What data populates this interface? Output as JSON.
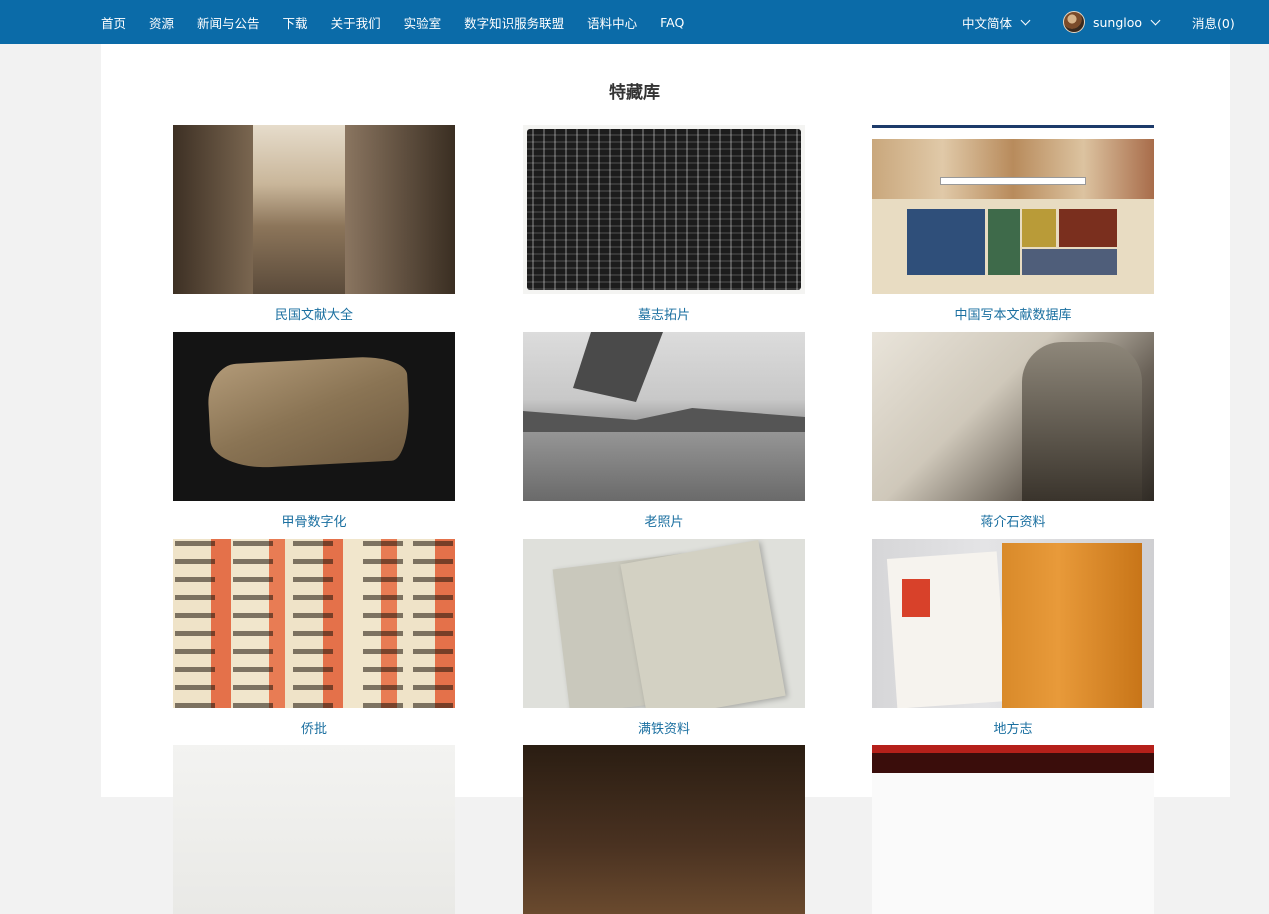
{
  "nav": {
    "items": [
      "首页",
      "资源",
      "新闻与公告",
      "下载",
      "关于我们",
      "实验室",
      "数字知识服务联盟",
      "语料中心",
      "FAQ"
    ]
  },
  "header_right": {
    "language": "中文简体",
    "username": "sungloo",
    "messages": "消息(0)"
  },
  "page": {
    "title": "特藏库"
  },
  "collections": [
    {
      "label": "民国文献大全"
    },
    {
      "label": "墓志拓片"
    },
    {
      "label": "中国写本文献数据库"
    },
    {
      "label": "甲骨数字化"
    },
    {
      "label": "老照片"
    },
    {
      "label": "蒋介石资料"
    },
    {
      "label": "侨批"
    },
    {
      "label": "满铁资料"
    },
    {
      "label": "地方志"
    }
  ],
  "colors": {
    "header_bg": "#0b6ba8",
    "caption": "#1a6fa0"
  }
}
